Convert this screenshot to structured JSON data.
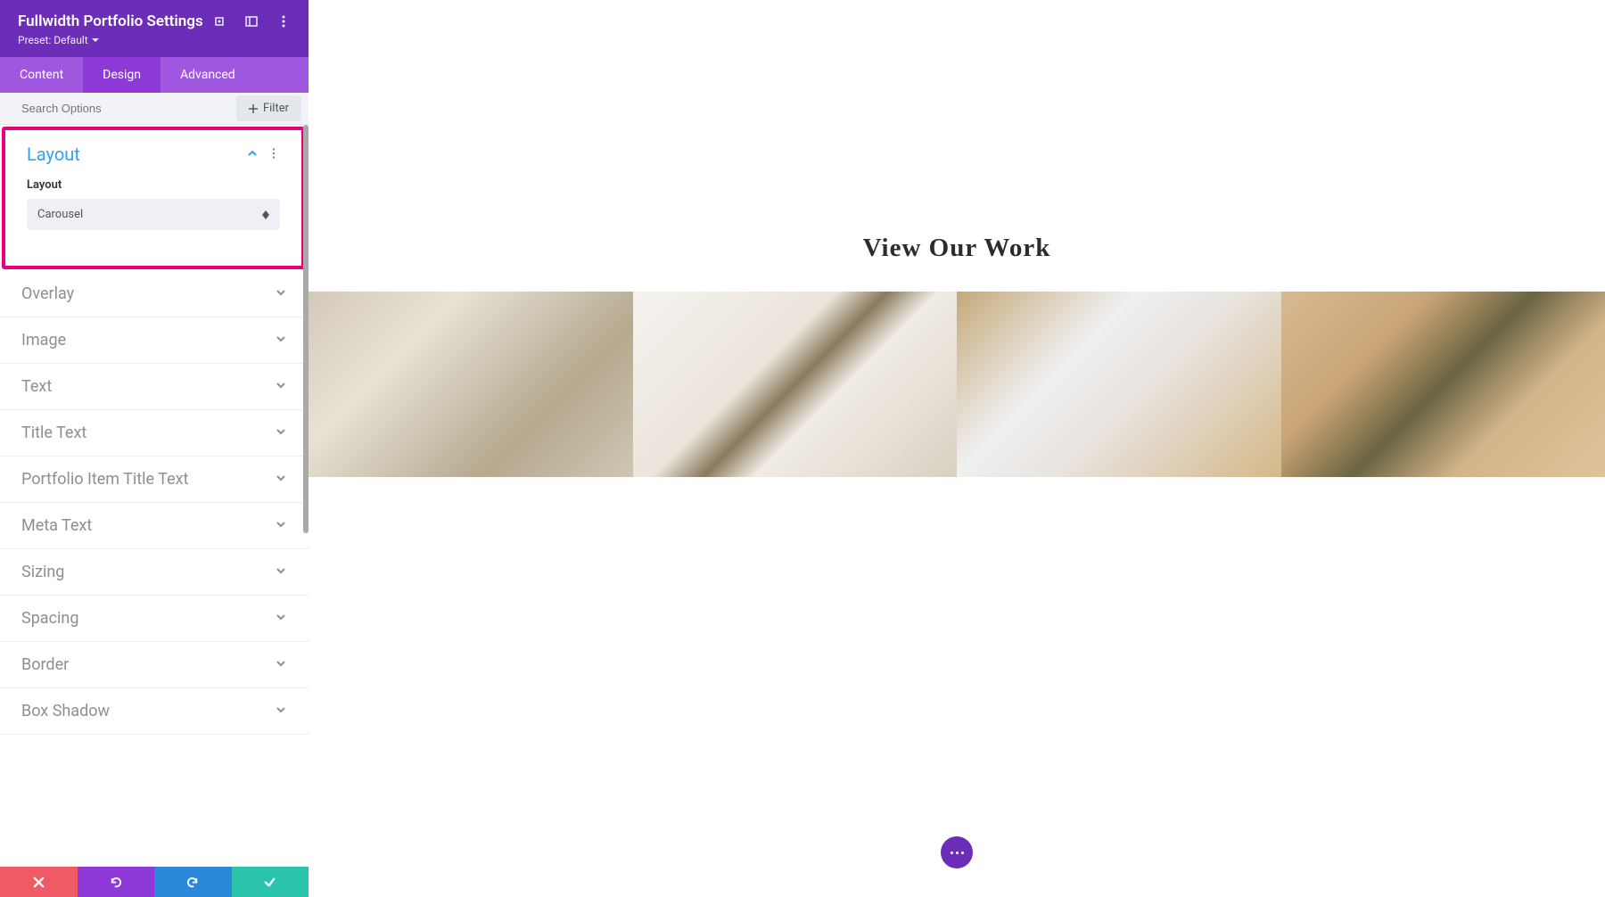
{
  "header": {
    "title": "Fullwidth Portfolio Settings",
    "preset": "Preset: Default"
  },
  "tabs": {
    "content": "Content",
    "design": "Design",
    "advanced": "Advanced"
  },
  "search": {
    "placeholder": "Search Options",
    "filter": "Filter"
  },
  "sections": {
    "layout": {
      "title": "Layout",
      "field_label": "Layout",
      "value": "Carousel"
    },
    "overlay": "Overlay",
    "image": "Image",
    "text": "Text",
    "title_text": "Title Text",
    "portfolio_item_title": "Portfolio Item Title Text",
    "meta_text": "Meta Text",
    "sizing": "Sizing",
    "spacing": "Spacing",
    "border": "Border",
    "box_shadow": "Box Shadow"
  },
  "preview": {
    "heading": "View Our Work"
  }
}
